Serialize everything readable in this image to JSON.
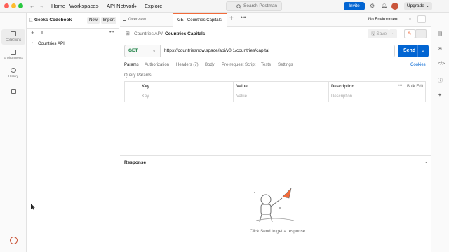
{
  "titlebar": {
    "nav": [
      "Home",
      "Workspaces",
      "API Network",
      "Explore"
    ],
    "search_placeholder": "Search Postman",
    "invite": "Invite",
    "upgrade": "Upgrade"
  },
  "leftnav": {
    "items": [
      "Collections",
      "Environments",
      "History"
    ]
  },
  "sidebar": {
    "workspace": "Geeks Codebook",
    "new_label": "New",
    "import_label": "Import",
    "tree": [
      "Countries API"
    ]
  },
  "tabs": {
    "items": [
      "Overview",
      "GET Countries Capitals"
    ],
    "environment": "No Environment"
  },
  "request": {
    "breadcrumb_parent": "Countries API",
    "breadcrumb_sep": "/",
    "title": "Countries Capitals",
    "save_label": "Save",
    "method": "GET",
    "url": "https://countriesnow.space/api/v0.1/countries/capital",
    "send_label": "Send",
    "cookies_label": "Cookies",
    "subtabs": [
      "Params",
      "Authorization",
      "Headers (7)",
      "Body",
      "Pre-request Script",
      "Tests",
      "Settings"
    ],
    "query_params_label": "Query Params",
    "table_headers": [
      "Key",
      "Value",
      "Description"
    ],
    "bulk_edit": "Bulk Edit",
    "row_placeholders": [
      "Key",
      "Value",
      "Description"
    ]
  },
  "response": {
    "label": "Response",
    "empty_text": "Click Send to get a response"
  },
  "colors": {
    "accent": "#f26b3a",
    "primary": "#0265d2",
    "get_method": "#0f7a3a"
  }
}
